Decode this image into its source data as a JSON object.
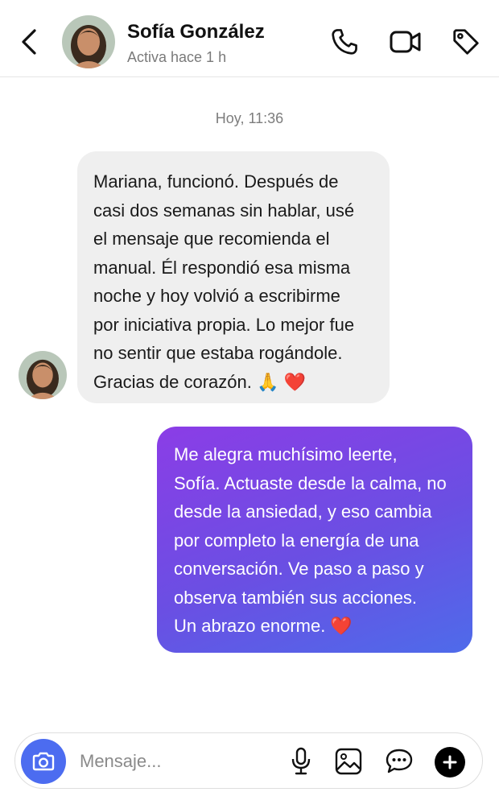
{
  "header": {
    "contact_name": "Sofía González",
    "status": "Activa hace 1 h",
    "icons": [
      "back-arrow-icon",
      "phone-icon",
      "video-camera-icon",
      "tag-icon"
    ]
  },
  "conversation": {
    "timestamp": "Hoy, 11:36",
    "messages": [
      {
        "direction": "incoming",
        "text": "Mariana, funcionó. Después de\ncasi dos semanas sin hablar, usé\nel mensaje que recomienda el\nmanual. Él respondió esa misma\nnoche y hoy volvió a escribirme\npor iniciativa propia. Lo mejor fue\nno sentir que estaba rogándole.\nGracias de corazón. 🙏 ❤️"
      },
      {
        "direction": "outgoing",
        "text": "Me alegra muchísimo leerte,\nSofía. Actuaste desde la calma, no\ndesde la ansiedad, y eso cambia\npor completo la energía de una\nconversación. Ve paso a paso y\nobserva también sus acciones.\nUn abrazo enorme. ❤️"
      }
    ]
  },
  "composer": {
    "placeholder": "Mensaje...",
    "icons": [
      "camera-icon",
      "microphone-icon",
      "gallery-icon",
      "sticker-icon",
      "plus-icon"
    ]
  },
  "colors": {
    "outgoing_gradient_start": "#8b3de6",
    "outgoing_gradient_end": "#4e6bea",
    "incoming_bubble": "#efefef",
    "camera_button": "#4c6cf0"
  }
}
